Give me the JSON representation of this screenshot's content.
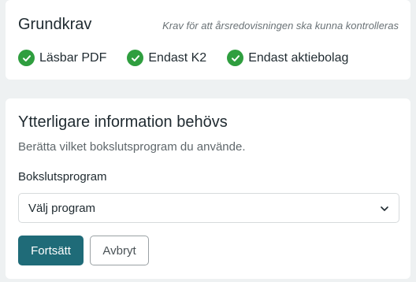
{
  "requirements": {
    "title": "Grundkrav",
    "note": "Krav för att årsredovisningen ska kunna kontrolleras",
    "items": [
      {
        "label": "Läsbar PDF",
        "icon": "check-circle-icon"
      },
      {
        "label": "Endast K2",
        "icon": "check-circle-icon"
      },
      {
        "label": "Endast aktiebolag",
        "icon": "check-circle-icon"
      }
    ]
  },
  "info": {
    "title": "Ytterligare information behövs",
    "description": "Berätta vilket bokslutsprogram du använde.",
    "field_label": "Bokslutsprogram",
    "select_value": "Välj program"
  },
  "actions": {
    "continue_label": "Fortsätt",
    "cancel_label": "Avbryt"
  },
  "colors": {
    "success": "#2f9e3f",
    "primary": "#1f6b78",
    "background": "#eef1f2"
  }
}
